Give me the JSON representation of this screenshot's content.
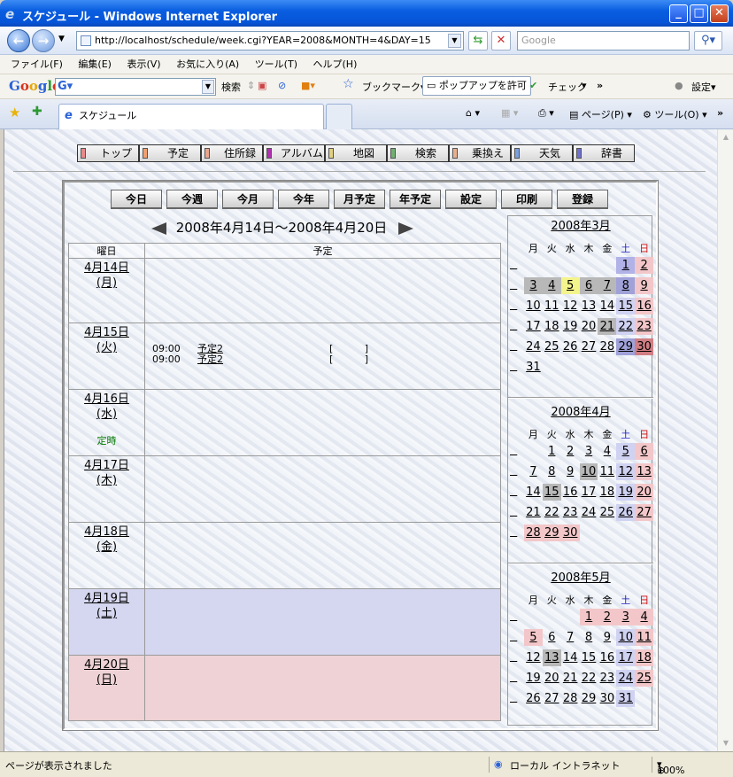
{
  "window": {
    "title": "スケジュール - Windows Internet Explorer"
  },
  "address_bar": {
    "url": "http://localhost/schedule/week.cgi?YEAR=2008&MONTH=4&DAY=15",
    "search_placeholder": "Google"
  },
  "menu": [
    "ファイル(F)",
    "編集(E)",
    "表示(V)",
    "お気に入り(A)",
    "ツール(T)",
    "ヘルプ(H)"
  ],
  "google_toolbar": {
    "logo": "Google",
    "search_label": "検索",
    "bookmark_label": "ブックマーク▾",
    "popup_label": "ポップアップを許可",
    "check_label": "チェック",
    "settings_label": "設定▾"
  },
  "tab": {
    "title": "スケジュール",
    "page_label": "ページ(P)",
    "tools_label": "ツール(O)"
  },
  "app_nav": [
    {
      "label": "トップ",
      "color": "#e88a8a"
    },
    {
      "label": "予定",
      "color": "#f0a070"
    },
    {
      "label": "住所録",
      "color": "#e9a58e"
    },
    {
      "label": "アルバム",
      "color": "#b030b0"
    },
    {
      "label": "地図",
      "color": "#e0d080"
    },
    {
      "label": "検索",
      "color": "#70b070"
    },
    {
      "label": "乗換え",
      "color": "#e8b090"
    },
    {
      "label": "天気",
      "color": "#7aa0e0"
    },
    {
      "label": "辞書",
      "color": "#7070d0"
    }
  ],
  "toolbar_buttons": [
    "今日",
    "今週",
    "今月",
    "今年",
    "月予定",
    "年予定",
    "設定",
    "印刷",
    "登録"
  ],
  "week": {
    "title": "2008年4月14日～2008年4月20日",
    "headers": {
      "day": "曜日",
      "schedule": "予定"
    },
    "days": [
      {
        "date": "4月14日",
        "weekday": "(月)",
        "events": [],
        "note": "",
        "kind": "weekday"
      },
      {
        "date": "4月15日",
        "weekday": "(火)",
        "events": [
          {
            "time": "09:00",
            "name": "予定2",
            "open": "[",
            "close": "]"
          },
          {
            "time": "09:00",
            "name": "予定2",
            "open": "[",
            "close": "]"
          }
        ],
        "note": "",
        "kind": "weekday"
      },
      {
        "date": "4月16日",
        "weekday": "(水)",
        "events": [],
        "note": "定時",
        "kind": "weekday"
      },
      {
        "date": "4月17日",
        "weekday": "(木)",
        "events": [],
        "note": "",
        "kind": "weekday"
      },
      {
        "date": "4月18日",
        "weekday": "(金)",
        "events": [],
        "note": "",
        "kind": "weekday"
      },
      {
        "date": "4月19日",
        "weekday": "(土)",
        "events": [],
        "note": "",
        "kind": "sat"
      },
      {
        "date": "4月20日",
        "weekday": "(日)",
        "events": [],
        "note": "",
        "kind": "sun"
      }
    ]
  },
  "mini_calendars": [
    {
      "title": "2008年3月",
      "weekdays": [
        "月",
        "火",
        "水",
        "木",
        "金",
        "土",
        "日"
      ],
      "weeks": [
        [
          {
            "d": ""
          },
          {
            "d": ""
          },
          {
            "d": ""
          },
          {
            "d": ""
          },
          {
            "d": ""
          },
          {
            "d": "1",
            "hl": "b"
          },
          {
            "d": "2",
            "hl": "lp"
          }
        ],
        [
          {
            "d": "3",
            "hl": "g"
          },
          {
            "d": "4",
            "hl": "g"
          },
          {
            "d": "5",
            "hl": "y"
          },
          {
            "d": "6",
            "hl": "g"
          },
          {
            "d": "7",
            "hl": "g"
          },
          {
            "d": "8",
            "hl": "bg"
          },
          {
            "d": "9",
            "hl": "lp"
          }
        ],
        [
          {
            "d": "10"
          },
          {
            "d": "11"
          },
          {
            "d": "12"
          },
          {
            "d": "13"
          },
          {
            "d": "14"
          },
          {
            "d": "15",
            "hl": "lb"
          },
          {
            "d": "16",
            "hl": "lp"
          }
        ],
        [
          {
            "d": "17"
          },
          {
            "d": "18"
          },
          {
            "d": "19"
          },
          {
            "d": "20"
          },
          {
            "d": "21",
            "hl": "g"
          },
          {
            "d": "22",
            "hl": "lb"
          },
          {
            "d": "23",
            "hl": "lp"
          }
        ],
        [
          {
            "d": "24"
          },
          {
            "d": "25"
          },
          {
            "d": "26"
          },
          {
            "d": "27"
          },
          {
            "d": "28"
          },
          {
            "d": "29",
            "hl": "bg"
          },
          {
            "d": "30",
            "hl": "dp"
          }
        ],
        [
          {
            "d": "31"
          },
          {
            "d": ""
          },
          {
            "d": ""
          },
          {
            "d": ""
          },
          {
            "d": ""
          },
          {
            "d": ""
          },
          {
            "d": ""
          }
        ]
      ]
    },
    {
      "title": "2008年4月",
      "weekdays": [
        "月",
        "火",
        "水",
        "木",
        "金",
        "土",
        "日"
      ],
      "weeks": [
        [
          {
            "d": ""
          },
          {
            "d": "1"
          },
          {
            "d": "2"
          },
          {
            "d": "3"
          },
          {
            "d": "4"
          },
          {
            "d": "5",
            "hl": "lb"
          },
          {
            "d": "6",
            "hl": "lp"
          }
        ],
        [
          {
            "d": "7"
          },
          {
            "d": "8"
          },
          {
            "d": "9"
          },
          {
            "d": "10",
            "hl": "g"
          },
          {
            "d": "11"
          },
          {
            "d": "12",
            "hl": "lb"
          },
          {
            "d": "13",
            "hl": "lp"
          }
        ],
        [
          {
            "d": "14"
          },
          {
            "d": "15",
            "hl": "g"
          },
          {
            "d": "16"
          },
          {
            "d": "17"
          },
          {
            "d": "18"
          },
          {
            "d": "19",
            "hl": "lb"
          },
          {
            "d": "20",
            "hl": "lp"
          }
        ],
        [
          {
            "d": "21"
          },
          {
            "d": "22"
          },
          {
            "d": "23"
          },
          {
            "d": "24"
          },
          {
            "d": "25"
          },
          {
            "d": "26",
            "hl": "lb"
          },
          {
            "d": "27",
            "hl": "lp"
          }
        ],
        [
          {
            "d": "28",
            "hl": "lp"
          },
          {
            "d": "29",
            "hl": "lp"
          },
          {
            "d": "30",
            "hl": "lp"
          },
          {
            "d": ""
          },
          {
            "d": ""
          },
          {
            "d": ""
          },
          {
            "d": ""
          }
        ]
      ]
    },
    {
      "title": "2008年5月",
      "weekdays": [
        "月",
        "火",
        "水",
        "木",
        "金",
        "土",
        "日"
      ],
      "weeks": [
        [
          {
            "d": ""
          },
          {
            "d": ""
          },
          {
            "d": ""
          },
          {
            "d": "1",
            "hl": "lp"
          },
          {
            "d": "2",
            "hl": "lp"
          },
          {
            "d": "3",
            "hl": "lp"
          },
          {
            "d": "4",
            "hl": "lp"
          }
        ],
        [
          {
            "d": "5",
            "hl": "lp"
          },
          {
            "d": "6"
          },
          {
            "d": "7"
          },
          {
            "d": "8"
          },
          {
            "d": "9"
          },
          {
            "d": "10",
            "hl": "lb"
          },
          {
            "d": "11",
            "hl": "lp"
          }
        ],
        [
          {
            "d": "12"
          },
          {
            "d": "13",
            "hl": "g"
          },
          {
            "d": "14"
          },
          {
            "d": "15"
          },
          {
            "d": "16"
          },
          {
            "d": "17",
            "hl": "lb"
          },
          {
            "d": "18",
            "hl": "lp"
          }
        ],
        [
          {
            "d": "19"
          },
          {
            "d": "20"
          },
          {
            "d": "21"
          },
          {
            "d": "22"
          },
          {
            "d": "23"
          },
          {
            "d": "24",
            "hl": "lb"
          },
          {
            "d": "25",
            "hl": "lp"
          }
        ],
        [
          {
            "d": "26"
          },
          {
            "d": "27"
          },
          {
            "d": "28"
          },
          {
            "d": "29"
          },
          {
            "d": "30"
          },
          {
            "d": "31",
            "hl": "lb"
          },
          {
            "d": ""
          }
        ]
      ]
    }
  ],
  "status_bar": {
    "message": "ページが表示されました",
    "zone": "ローカル イントラネット",
    "zoom": "100%"
  }
}
